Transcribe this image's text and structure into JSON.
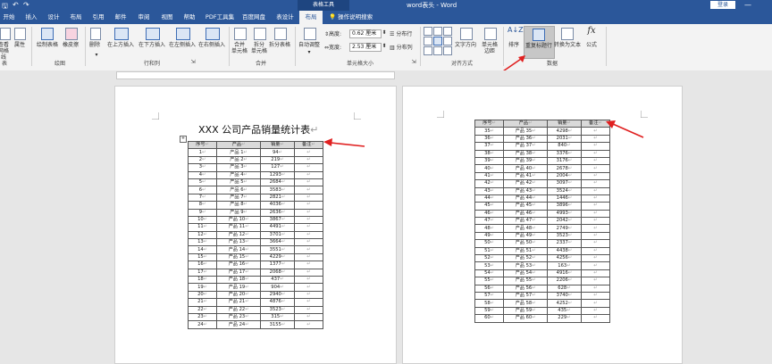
{
  "window": {
    "title": "word表头 - Word",
    "context_tab": "表格工具",
    "login_label": "登录",
    "minimize_glyph": "—"
  },
  "quick_access": {
    "save_glyph": "🖫",
    "undo_glyph": "↶",
    "redo_glyph": "↷"
  },
  "tabs": [
    {
      "label": "开始",
      "active": false
    },
    {
      "label": "插入",
      "active": false
    },
    {
      "label": "设计",
      "active": false
    },
    {
      "label": "布局",
      "active": false
    },
    {
      "label": "引用",
      "active": false
    },
    {
      "label": "邮件",
      "active": false
    },
    {
      "label": "审阅",
      "active": false
    },
    {
      "label": "视图",
      "active": false
    },
    {
      "label": "帮助",
      "active": false
    },
    {
      "label": "PDF工具集",
      "active": false
    },
    {
      "label": "百度网盘",
      "active": false
    },
    {
      "label": "表设计",
      "active": false
    },
    {
      "label": "布局",
      "active": true
    }
  ],
  "tell_me": "操作说明搜索",
  "ribbon": {
    "table_group": {
      "label": "表",
      "view_grid_line1": "查看",
      "view_grid_line2": "网格线",
      "properties": "属性"
    },
    "draw_group": {
      "label": "绘图",
      "draw_table": "绘制表格",
      "eraser": "橡皮擦"
    },
    "rows_cols_group": {
      "label": "行和列",
      "delete": "删除",
      "insert_above": "在上方插入",
      "insert_below": "在下方插入",
      "insert_left": "在左侧插入",
      "insert_right": "在右侧插入"
    },
    "merge_group": {
      "label": "合并",
      "merge_cells_l1": "合并",
      "merge_cells_l2": "单元格",
      "split_cells_l1": "拆分",
      "split_cells_l2": "单元格",
      "split_table": "拆分表格"
    },
    "cell_size_group": {
      "label": "单元格大小",
      "autofit": "自动调整",
      "height_label": "高度:",
      "height_value": "0.62 厘米",
      "width_label": "宽度:",
      "width_value": "2.53 厘米",
      "distribute_rows": "分布行",
      "distribute_cols": "分布列"
    },
    "alignment_group": {
      "label": "对齐方式",
      "text_direction": "文字方向",
      "cell_margins_l1": "单元格",
      "cell_margins_l2": "边距"
    },
    "data_group": {
      "label": "数据",
      "sort": "排序",
      "repeat_header": "重复标题行",
      "convert_to_text": "转换为文本",
      "formula": "公式",
      "formula_glyph": "fx",
      "sort_glyph": "A↓Z"
    }
  },
  "document": {
    "heading": "XXX 公司产品销量统计表",
    "paragraph_mark": "↵",
    "move_handle_glyph": "+",
    "headers": [
      "序号",
      "产品",
      "销量",
      "备注"
    ],
    "table1_rows": [
      [
        "1",
        "产品 1",
        "94",
        ""
      ],
      [
        "2",
        "产品 2",
        "219",
        ""
      ],
      [
        "3",
        "产品 3",
        "127",
        ""
      ],
      [
        "4",
        "产品 4",
        "1293",
        ""
      ],
      [
        "5",
        "产品 5",
        "2684",
        ""
      ],
      [
        "6",
        "产品 6",
        "3583",
        ""
      ],
      [
        "7",
        "产品 7",
        "2821",
        ""
      ],
      [
        "8",
        "产品 8",
        "4036",
        ""
      ],
      [
        "9",
        "产品 9",
        "2636",
        ""
      ],
      [
        "10",
        "产品 10",
        "3867",
        ""
      ],
      [
        "11",
        "产品 11",
        "4491",
        ""
      ],
      [
        "12",
        "产品 12",
        "3701",
        ""
      ],
      [
        "13",
        "产品 13",
        "3664",
        ""
      ],
      [
        "14",
        "产品 14",
        "3551",
        ""
      ],
      [
        "15",
        "产品 15",
        "4229",
        ""
      ],
      [
        "16",
        "产品 16",
        "1377",
        ""
      ],
      [
        "17",
        "产品 17",
        "2068",
        ""
      ],
      [
        "18",
        "产品 18",
        "437",
        ""
      ],
      [
        "19",
        "产品 19",
        "904",
        ""
      ],
      [
        "20",
        "产品 20",
        "2940",
        ""
      ],
      [
        "21",
        "产品 21",
        "4876",
        ""
      ],
      [
        "22",
        "产品 22",
        "3523",
        ""
      ],
      [
        "23",
        "产品 23",
        "315",
        ""
      ],
      [
        "24",
        "产品 24",
        "3155",
        ""
      ]
    ],
    "table2_rows": [
      [
        "35",
        "产品 35",
        "4298",
        ""
      ],
      [
        "36",
        "产品 36",
        "2031",
        ""
      ],
      [
        "37",
        "产品 37",
        "840",
        ""
      ],
      [
        "38",
        "产品 38",
        "3376",
        ""
      ],
      [
        "39",
        "产品 39",
        "3176",
        ""
      ],
      [
        "40",
        "产品 40",
        "2678",
        ""
      ],
      [
        "41",
        "产品 41",
        "2004",
        ""
      ],
      [
        "42",
        "产品 42",
        "3097",
        ""
      ],
      [
        "43",
        "产品 43",
        "3524",
        ""
      ],
      [
        "44",
        "产品 44",
        "1446",
        ""
      ],
      [
        "45",
        "产品 45",
        "3896",
        ""
      ],
      [
        "46",
        "产品 46",
        "4993",
        ""
      ],
      [
        "47",
        "产品 47",
        "2042",
        ""
      ],
      [
        "48",
        "产品 48",
        "2749",
        ""
      ],
      [
        "49",
        "产品 49",
        "3523",
        ""
      ],
      [
        "50",
        "产品 50",
        "2337",
        ""
      ],
      [
        "51",
        "产品 51",
        "4438",
        ""
      ],
      [
        "52",
        "产品 52",
        "4256",
        ""
      ],
      [
        "53",
        "产品 53",
        "163",
        ""
      ],
      [
        "54",
        "产品 54",
        "4916",
        ""
      ],
      [
        "55",
        "产品 55",
        "2206",
        ""
      ],
      [
        "56",
        "产品 56",
        "628",
        ""
      ],
      [
        "57",
        "产品 57",
        "3740",
        ""
      ],
      [
        "58",
        "产品 58",
        "4252",
        ""
      ],
      [
        "59",
        "产品 59",
        "435",
        ""
      ],
      [
        "60",
        "产品 60",
        "229",
        ""
      ]
    ]
  },
  "colors": {
    "accent": "#2b579a",
    "annotation_arrow": "#e02020"
  }
}
